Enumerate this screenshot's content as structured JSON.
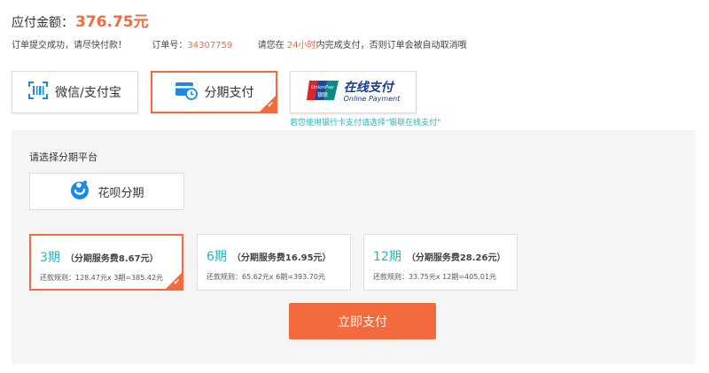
{
  "order": {
    "amount_label": "应付金额：",
    "amount_value": "376.75元",
    "notice": "订单提交成功，请尽快付款！",
    "order_no_label": "订单号：",
    "order_no": "34307759",
    "deadline_prefix": "请您在",
    "deadline_value": "24小时",
    "deadline_suffix": "内完成支付，否则订单会被自动取消哦"
  },
  "payment_methods": [
    {
      "label": "微信/支付宝",
      "icon": "scan-icon",
      "selected": false
    },
    {
      "label": "分期支付",
      "icon": "installment-card-icon",
      "selected": true
    },
    {
      "label": "在线支付",
      "sublabel": "Online Payment",
      "brand_top": "UnionPay",
      "brand_bottom": "银联",
      "icon": "unionpay-logo",
      "selected": false
    }
  ],
  "unionpay_tip": "若您使用银行卡支付请选择\"银联在线支付\"",
  "installment": {
    "title": "请选择分期平台",
    "platform": {
      "label": "花呗分期",
      "icon": "huabei-icon"
    },
    "plans": [
      {
        "term": "3期",
        "fee": "（分期服务费8.67元）",
        "rule": "还款规则：128.47元x 3期=385.42元",
        "selected": true
      },
      {
        "term": "6期",
        "fee": "（分期服务费16.95元）",
        "rule": "还款规则：65.62元x 6期=393.70元",
        "selected": false
      },
      {
        "term": "12期",
        "fee": "（分期服务费28.26元）",
        "rule": "还款规则：33.75元x 12期=405.01元",
        "selected": false
      }
    ]
  },
  "pay_button_label": "立即支付",
  "colors": {
    "accent": "#f36a3e",
    "teal": "#2bb5b8",
    "blue": "#1a8be0"
  }
}
